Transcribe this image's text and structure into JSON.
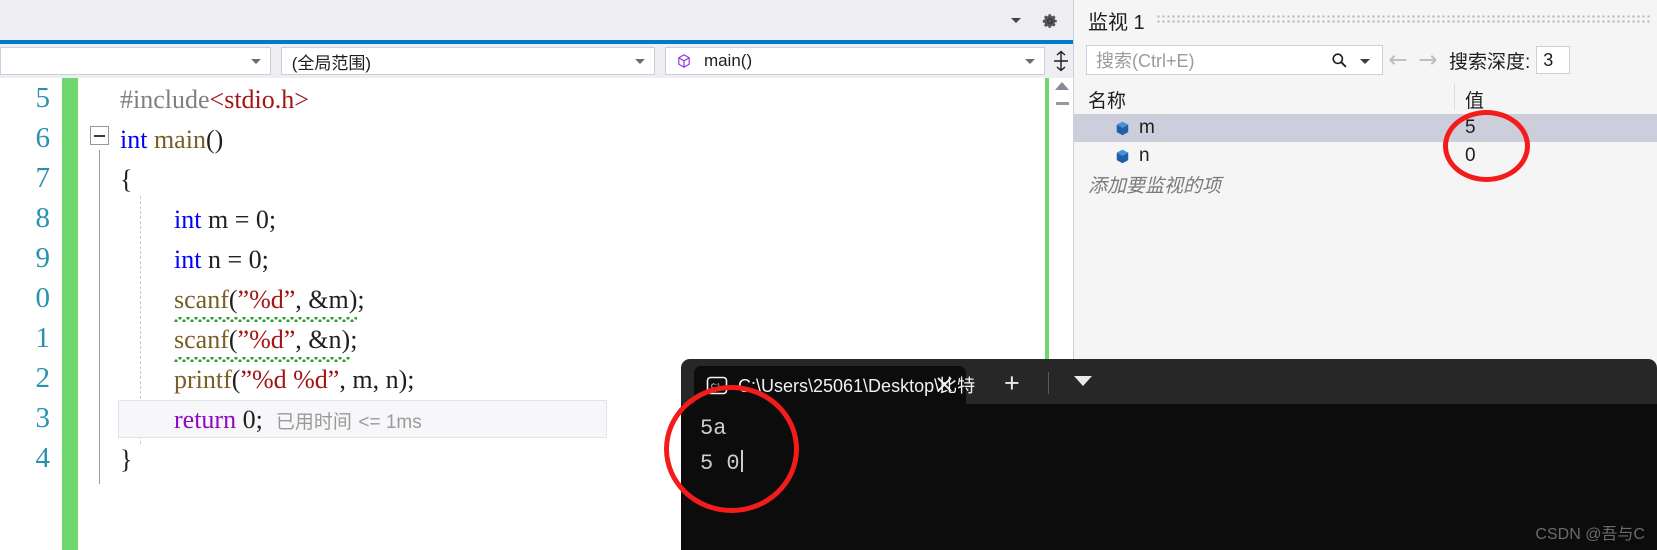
{
  "editor": {
    "nav": {
      "scope_combo_value": "",
      "scope_combo2_value": "(全局范围)",
      "function_combo_value": "main()"
    },
    "line_numbers": [
      "5",
      "6",
      "7",
      "8",
      "9",
      "0",
      "1",
      "2",
      "3",
      "4"
    ],
    "code_lines": [
      {
        "n": "5",
        "text": "#include<stdio.h>"
      },
      {
        "n": "6",
        "text": "int main()"
      },
      {
        "n": "7",
        "text": "{"
      },
      {
        "n": "8",
        "text": "int m = 0;"
      },
      {
        "n": "9",
        "text": "int n = 0;"
      },
      {
        "n": "0",
        "text": "scanf(\"%d\", &m);"
      },
      {
        "n": "1",
        "text": "scanf(\"%d\", &n);"
      },
      {
        "n": "2",
        "text": "printf(\"%d %d\", m, n);"
      },
      {
        "n": "3",
        "text": "return 0;"
      },
      {
        "n": "4",
        "text": "}"
      }
    ],
    "elapsed_time_label": "已用时间",
    "elapsed_time_value": "<= 1ms"
  },
  "watch": {
    "title": "监视 1",
    "search_placeholder": "搜索(Ctrl+E)",
    "prev_arrow": "←",
    "next_arrow": "→",
    "depth_label": "搜索深度:",
    "depth_value": "3",
    "columns": {
      "name": "名称",
      "value": "值"
    },
    "rows": [
      {
        "name": "m",
        "value": "5"
      },
      {
        "name": "n",
        "value": "0"
      }
    ],
    "add_item_placeholder": "添加要监视的项"
  },
  "terminal": {
    "tab_title": "C:\\Users\\25061\\Desktop\\比特",
    "new_tab_label": "+",
    "output_lines": [
      "5a",
      "5 0"
    ]
  },
  "watermark": "CSDN @吾与C",
  "colors": {
    "accent": "#007acc",
    "change_bar": "#6ed86e",
    "annotation": "#f41b1b",
    "selection": "#cccedb"
  }
}
